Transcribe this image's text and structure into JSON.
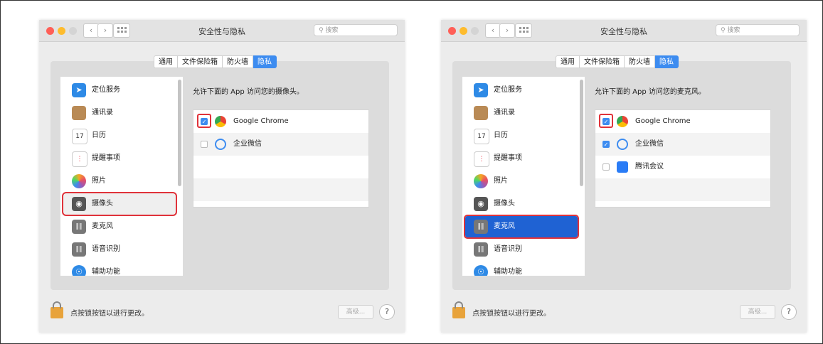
{
  "windows": [
    {
      "title": "安全性与隐私",
      "search_placeholder": "搜索",
      "tabs": [
        "通用",
        "文件保险箱",
        "防火墙",
        "隐私"
      ],
      "active_tab": "隐私",
      "sidebar": [
        "定位服务",
        "通讯录",
        "日历",
        "提醒事项",
        "照片",
        "摄像头",
        "麦克风",
        "语音识别",
        "辅助功能"
      ],
      "selected_sidebar": "摄像头",
      "prompt": "允许下面的 App 访问您的摄像头。",
      "apps": [
        {
          "name": "Google Chrome",
          "checked": true
        },
        {
          "name": "企业微信",
          "checked": false
        }
      ],
      "lock_text": "点按锁按钮以进行更改。",
      "advanced_label": "高级...",
      "help_label": "?"
    },
    {
      "title": "安全性与隐私",
      "search_placeholder": "搜索",
      "tabs": [
        "通用",
        "文件保险箱",
        "防火墙",
        "隐私"
      ],
      "active_tab": "隐私",
      "sidebar": [
        "定位服务",
        "通讯录",
        "日历",
        "提醒事项",
        "照片",
        "摄像头",
        "麦克风",
        "语音识别",
        "辅助功能"
      ],
      "selected_sidebar": "麦克风",
      "prompt": "允许下面的 App 访问您的麦克风。",
      "apps": [
        {
          "name": "Google Chrome",
          "checked": true
        },
        {
          "name": "企业微信",
          "checked": true
        },
        {
          "name": "腾讯会议",
          "checked": false
        }
      ],
      "lock_text": "点按锁按钮以进行更改。",
      "advanced_label": "高级...",
      "help_label": "?"
    }
  ],
  "colors": {
    "accent": "#3d8cf0",
    "highlight_red": "#e0323a",
    "selected_blue": "#1f62d3"
  },
  "icons": {
    "back": "chevron-left-icon",
    "forward": "chevron-right-icon",
    "grid": "grid-icon",
    "search": "search-icon",
    "lock": "lock-icon"
  }
}
